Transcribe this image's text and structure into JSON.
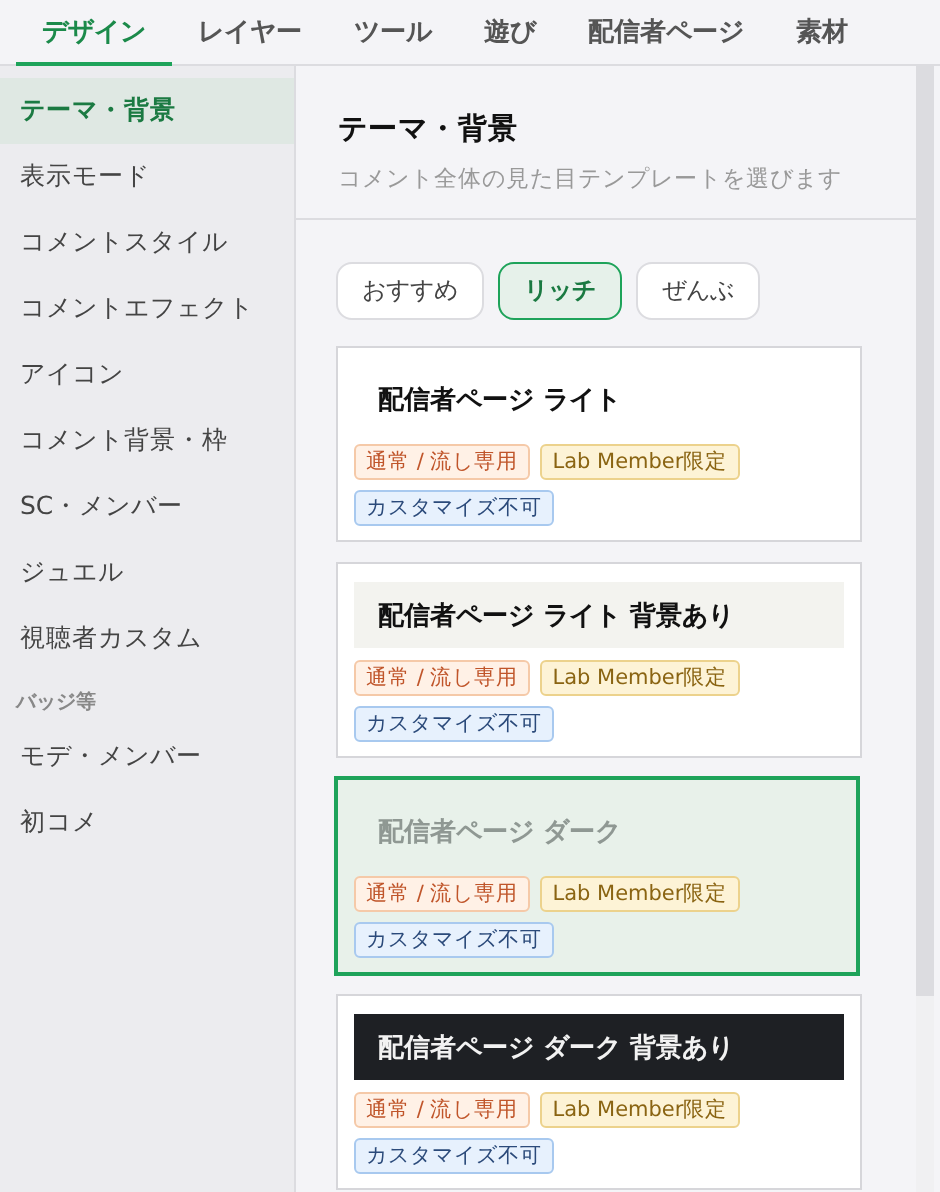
{
  "tabs": [
    {
      "label": "デザイン",
      "selected": true
    },
    {
      "label": "レイヤー",
      "selected": false
    },
    {
      "label": "ツール",
      "selected": false
    },
    {
      "label": "遊び",
      "selected": false
    },
    {
      "label": "配信者ページ",
      "selected": false
    },
    {
      "label": "素材",
      "selected": false
    }
  ],
  "sidebar": {
    "items": [
      {
        "kind": "item",
        "label": "テーマ・背景",
        "selected": true
      },
      {
        "kind": "item",
        "label": "表示モード",
        "selected": false
      },
      {
        "kind": "item",
        "label": "コメントスタイル",
        "selected": false
      },
      {
        "kind": "item",
        "label": "コメントエフェクト",
        "selected": false
      },
      {
        "kind": "item",
        "label": "アイコン",
        "selected": false
      },
      {
        "kind": "item",
        "label": "コメント背景・枠",
        "selected": false
      },
      {
        "kind": "item",
        "label": "SC・メンバー",
        "selected": false
      },
      {
        "kind": "item",
        "label": "ジュエル",
        "selected": false
      },
      {
        "kind": "item",
        "label": "視聴者カスタム",
        "selected": false
      },
      {
        "kind": "section",
        "label": "バッジ等"
      },
      {
        "kind": "item",
        "label": "モデ・メンバー",
        "selected": false
      },
      {
        "kind": "item",
        "label": "初コメ",
        "selected": false
      }
    ]
  },
  "panel": {
    "title": "テーマ・背景",
    "subtitle": "コメント全体の見た目テンプレートを選びます",
    "filters": [
      {
        "label": "おすすめ",
        "selected": false
      },
      {
        "label": "リッチ",
        "selected": true
      },
      {
        "label": "ぜんぶ",
        "selected": false
      }
    ],
    "templates": [
      {
        "name": "配信者ページ ライト",
        "kind": "plain",
        "selected": false,
        "tags": [
          {
            "text": "通常 / 流し専用",
            "kind": "orange"
          },
          {
            "text": "Lab Member限定",
            "kind": "yellow"
          },
          {
            "text": "カスタマイズ不可",
            "kind": "blue"
          }
        ]
      },
      {
        "name": "配信者ページ ライト 背景あり",
        "kind": "tinted",
        "selected": false,
        "tags": [
          {
            "text": "通常 / 流し専用",
            "kind": "orange"
          },
          {
            "text": "Lab Member限定",
            "kind": "yellow"
          },
          {
            "text": "カスタマイズ不可",
            "kind": "blue"
          }
        ]
      },
      {
        "name": "配信者ページ ダーク",
        "kind": "ghost",
        "selected": true,
        "tags": [
          {
            "text": "通常 / 流し専用",
            "kind": "orange"
          },
          {
            "text": "Lab Member限定",
            "kind": "yellow"
          },
          {
            "text": "カスタマイズ不可",
            "kind": "blue"
          }
        ]
      },
      {
        "name": "配信者ページ ダーク 背景あり",
        "kind": "dark",
        "selected": false,
        "tags": [
          {
            "text": "通常 / 流し専用",
            "kind": "orange"
          },
          {
            "text": "Lab Member限定",
            "kind": "yellow"
          },
          {
            "text": "カスタマイズ不可",
            "kind": "blue"
          }
        ]
      }
    ]
  }
}
